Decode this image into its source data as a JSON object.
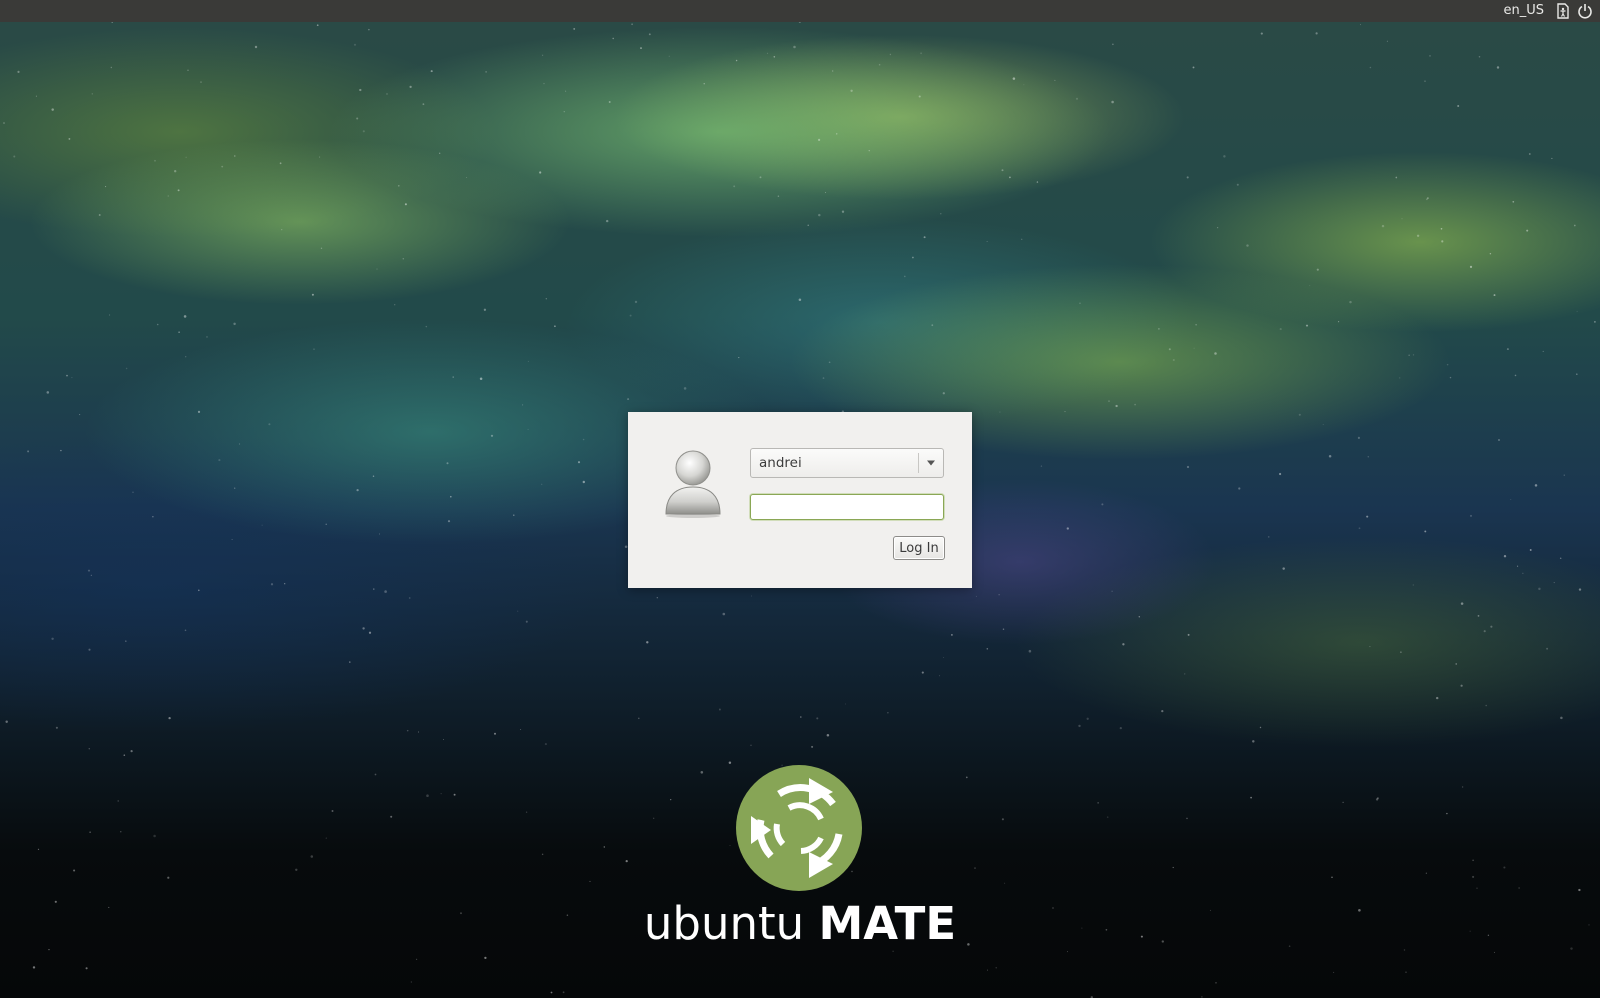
{
  "top_panel": {
    "language": "en_US",
    "icons": [
      "accessibility-icon",
      "power-icon"
    ]
  },
  "login": {
    "selected_user": "andrei",
    "password_value": "",
    "login_button_label": "Log In",
    "avatar_icon": "user-avatar-icon"
  },
  "branding": {
    "logo_icon": "ubuntu-mate-logo",
    "name_light": "ubuntu",
    "name_bold": "MATE",
    "logo_color": "#87a556"
  },
  "colors": {
    "panel": "#3a3a38",
    "dialog": "#f1f0ee",
    "focus_accent": "#8aa755"
  }
}
